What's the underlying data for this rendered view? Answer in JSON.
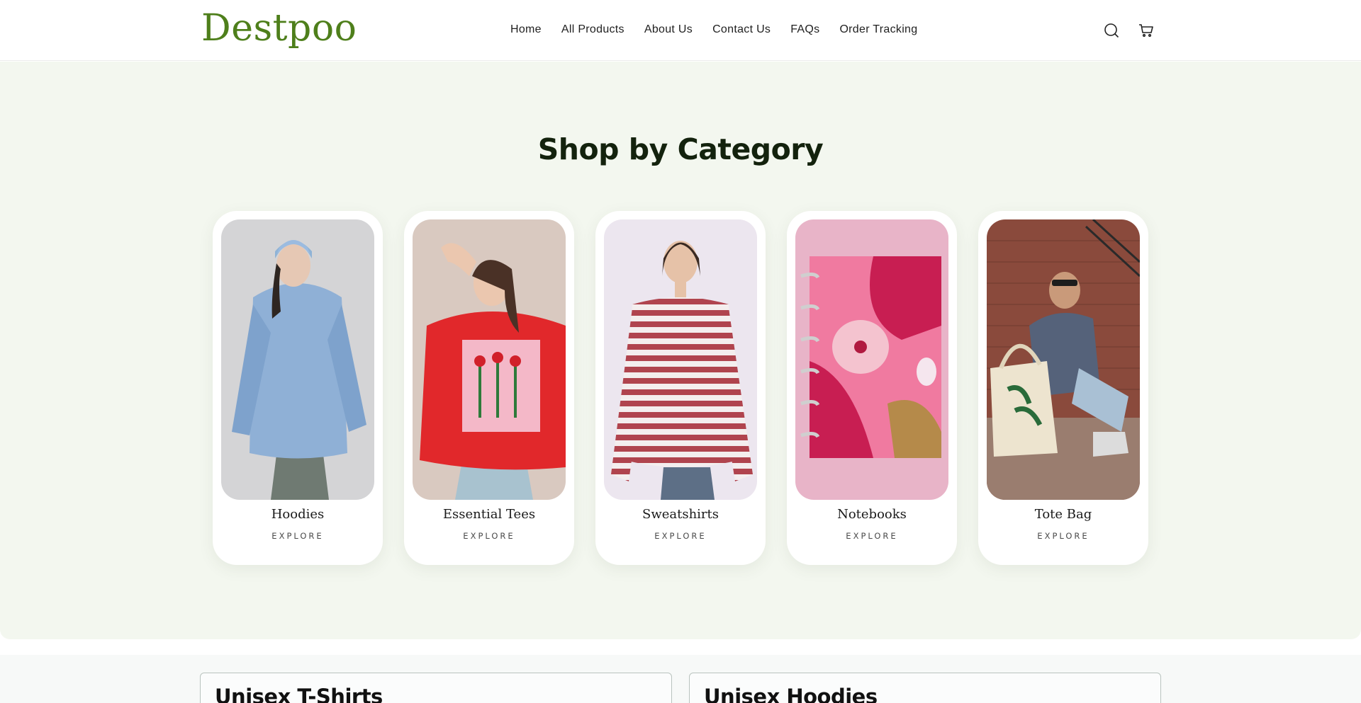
{
  "header": {
    "logo": "Destpoo",
    "nav": [
      "Home",
      "All Products",
      "About Us",
      "Contact Us",
      "FAQs",
      "Order Tracking"
    ],
    "icons": [
      "search-icon",
      "cart-icon"
    ]
  },
  "categories": {
    "title": "Shop by Category",
    "items": [
      {
        "name": "Hoodies",
        "cta": "EXPLORE"
      },
      {
        "name": "Essential Tees",
        "cta": "EXPLORE"
      },
      {
        "name": "Sweatshirts",
        "cta": "EXPLORE"
      },
      {
        "name": "Notebooks",
        "cta": "EXPLORE"
      },
      {
        "name": "Tote Bag",
        "cta": "EXPLORE"
      }
    ]
  },
  "collections": {
    "left_title": "Unisex T-Shirts",
    "right_title": "Unisex Hoodies"
  },
  "colors": {
    "brand": "#4e7f1b",
    "section_bg": "#f3f7ef",
    "heading": "#13220d"
  }
}
